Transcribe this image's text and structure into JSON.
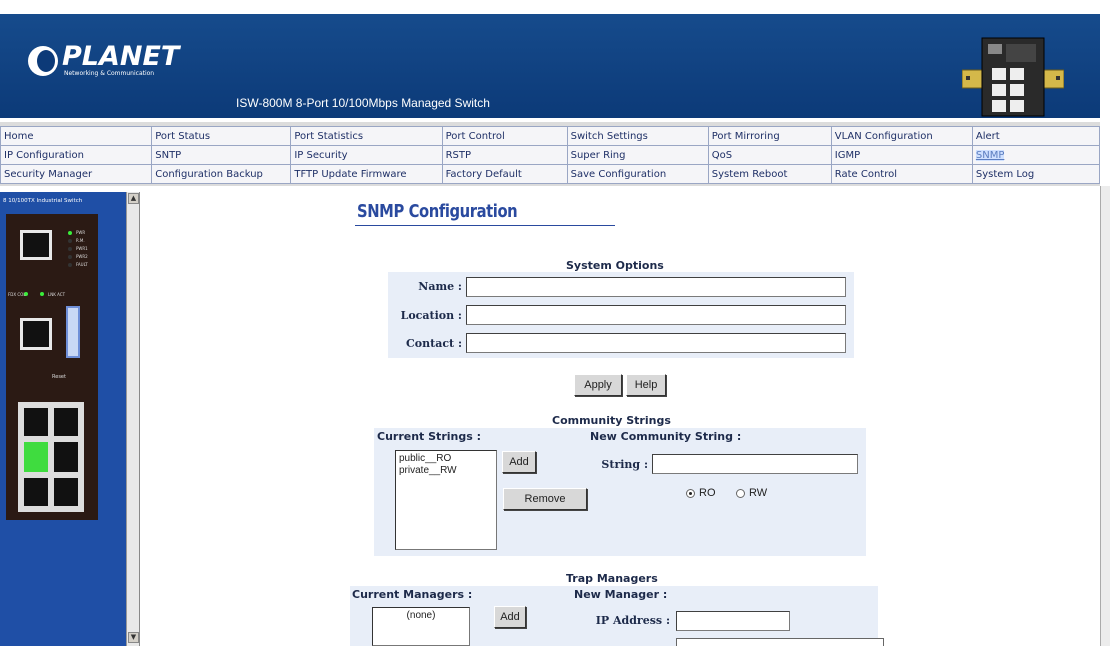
{
  "header": {
    "logo_text": "PLANET",
    "logo_tagline": "Networking & Communication",
    "product_title": "ISW-800M 8-Port 10/100Mbps Managed Switch"
  },
  "nav": {
    "rows": [
      [
        "Home",
        "Port Status",
        "Port Statistics",
        "Port Control",
        "Switch Settings",
        "Port Mirroring",
        "VLAN Configuration",
        "Alert"
      ],
      [
        "IP Configuration",
        "SNTP",
        "IP Security",
        "RSTP",
        "Super Ring",
        "QoS",
        "IGMP",
        "SNMP"
      ],
      [
        "Security Manager",
        "Configuration Backup",
        "TFTP Update Firmware",
        "Factory Default",
        "Save Configuration",
        "System Reboot",
        "Rate Control",
        "System Log"
      ]
    ],
    "active": "SNMP"
  },
  "device_panel": {
    "title": "8 10/100TX Industrial Switch",
    "led_labels": [
      "PWR",
      "R.M.",
      "PWR1",
      "PWR2",
      "FAULT"
    ],
    "fdx_label": "FDX COL",
    "lnk_label": "LNK ACT",
    "reset_label": "Reset"
  },
  "page": {
    "title": "SNMP Configuration"
  },
  "system_options": {
    "heading": "System Options",
    "name_label": "Name :",
    "location_label": "Location :",
    "contact_label": "Contact :",
    "name_value": "",
    "location_value": "",
    "contact_value": ""
  },
  "actions": {
    "apply": "Apply",
    "help": "Help"
  },
  "community": {
    "heading": "Community Strings",
    "current_label": "Current Strings :",
    "new_label": "New Community String :",
    "current_items": [
      "public__RO",
      "private__RW"
    ],
    "add": "Add",
    "remove": "Remove",
    "string_label": "String :",
    "string_value": "",
    "ro_label": "RO",
    "rw_label": "RW",
    "selected_access": "RO"
  },
  "trap": {
    "heading": "Trap Managers",
    "current_label": "Current Managers :",
    "new_label": "New Manager :",
    "current_items": [
      "(none)"
    ],
    "add": "Add",
    "ip_label": "IP Address :",
    "ip_value": ""
  }
}
